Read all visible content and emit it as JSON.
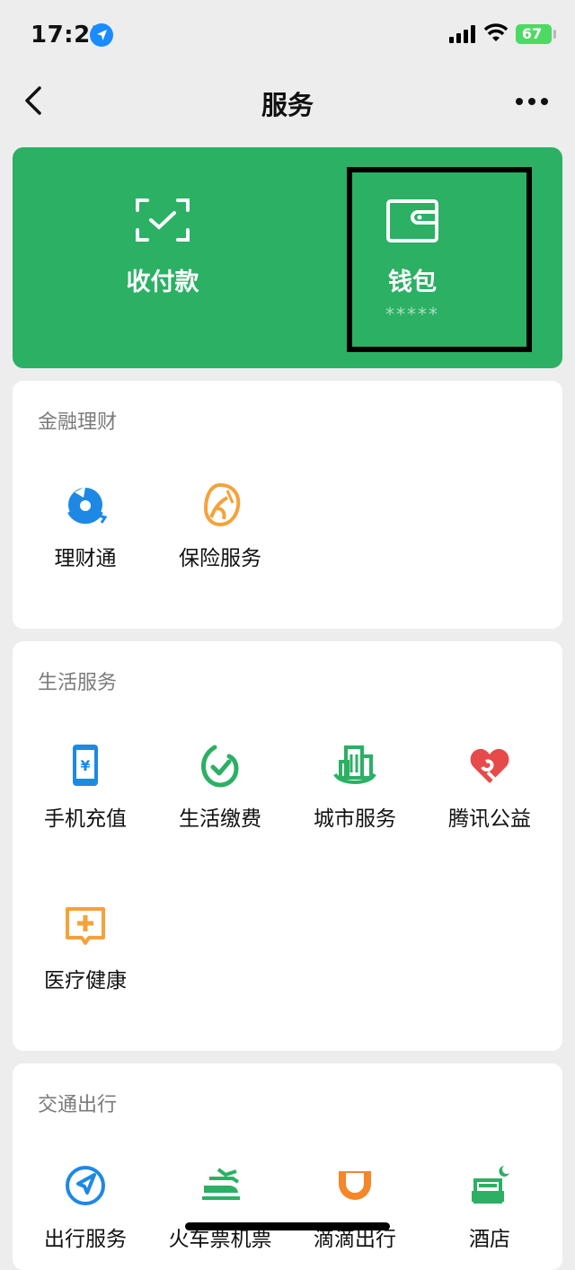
{
  "status_bar": {
    "time": "17:21",
    "battery": "67"
  },
  "nav": {
    "title": "服务"
  },
  "top_card": {
    "pay_label": "收付款",
    "wallet_label": "钱包",
    "wallet_balance": "*****"
  },
  "sections": {
    "finance": {
      "title": "金融理财",
      "items": [
        {
          "label": "理财通",
          "icon": "licaitong-icon"
        },
        {
          "label": "保险服务",
          "icon": "insurance-icon"
        }
      ]
    },
    "life": {
      "title": "生活服务",
      "items": [
        {
          "label": "手机充值",
          "icon": "phone-recharge-icon"
        },
        {
          "label": "生活缴费",
          "icon": "bill-payment-icon"
        },
        {
          "label": "城市服务",
          "icon": "city-service-icon"
        },
        {
          "label": "腾讯公益",
          "icon": "charity-heart-icon"
        },
        {
          "label": "医疗健康",
          "icon": "medical-icon"
        }
      ]
    },
    "travel": {
      "title": "交通出行",
      "items": [
        {
          "label": "出行服务",
          "icon": "travel-compass-icon"
        },
        {
          "label": "火车票机票",
          "icon": "train-ticket-icon"
        },
        {
          "label": "滴滴出行",
          "icon": "didi-icon"
        },
        {
          "label": "酒店",
          "icon": "hotel-bed-icon"
        }
      ]
    }
  },
  "colors": {
    "green": "#2bb064",
    "blue": "#1e88e5",
    "orange": "#f5a23a",
    "red": "#e64a4a",
    "item_green": "#2bb064"
  }
}
